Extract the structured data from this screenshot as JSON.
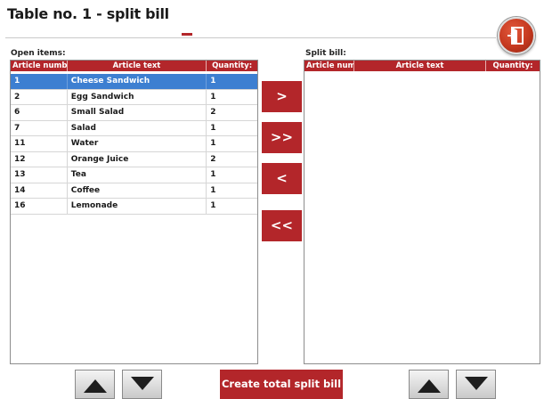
{
  "window": {
    "title": "Table no. 1 - split bill"
  },
  "left": {
    "label": "Open items:",
    "headers": {
      "number": "Article number",
      "text": "Article text",
      "qty": "Quantity:"
    },
    "rows": [
      {
        "number": "1",
        "text": "Cheese Sandwich",
        "qty": "1",
        "selected": true
      },
      {
        "number": "2",
        "text": "Egg Sandwich",
        "qty": "1"
      },
      {
        "number": "6",
        "text": "Small Salad",
        "qty": "2"
      },
      {
        "number": "7",
        "text": "Salad",
        "qty": "1"
      },
      {
        "number": "11",
        "text": "Water",
        "qty": "1"
      },
      {
        "number": "12",
        "text": "Orange Juice",
        "qty": "2"
      },
      {
        "number": "13",
        "text": "Tea",
        "qty": "1"
      },
      {
        "number": "14",
        "text": "Coffee",
        "qty": "1"
      },
      {
        "number": "16",
        "text": "Lemonade",
        "qty": "1"
      }
    ]
  },
  "right": {
    "label": "Split bill:",
    "headers": {
      "number": "Article number",
      "text": "Article text",
      "qty": "Quantity:"
    },
    "rows": []
  },
  "move_buttons": {
    "one_right": ">",
    "all_right": ">>",
    "one_left": "<",
    "all_left": "<<"
  },
  "footer": {
    "total_split_label": "Create total split bill"
  },
  "colors": {
    "accent": "#b3262a",
    "selection": "#3d7fd1",
    "exit": "#c5381f"
  },
  "icons": {
    "exit": "exit-door-icon",
    "up": "arrow-up-icon",
    "down": "arrow-down-icon"
  }
}
